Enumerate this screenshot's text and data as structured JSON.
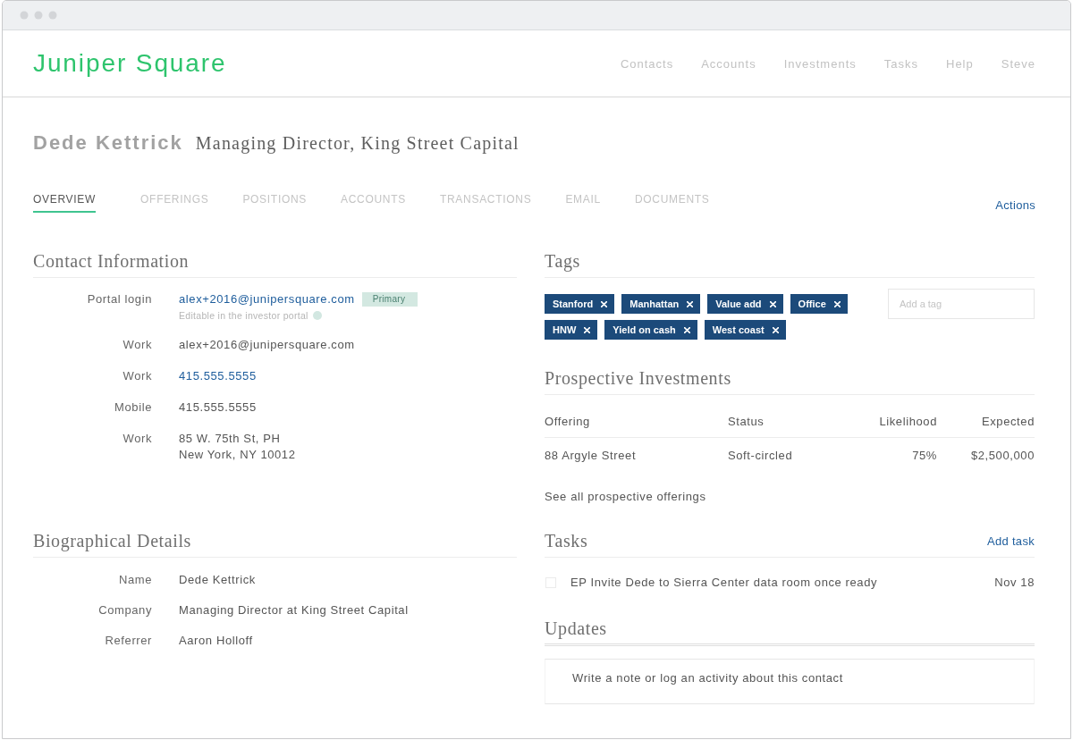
{
  "header": {
    "logo": "Juniper Square",
    "nav": [
      "Contacts",
      "Accounts",
      "Investments",
      "Tasks",
      "Help",
      "Steve"
    ]
  },
  "profile": {
    "name": "Dede Kettrick",
    "title": "Managing Director, King Street Capital"
  },
  "tabs": [
    {
      "label": "OVERVIEW",
      "selected": true
    },
    {
      "label": "OFFERINGS",
      "selected": false
    },
    {
      "label": "POSITIONS",
      "selected": false
    },
    {
      "label": "ACCOUNTS",
      "selected": false
    },
    {
      "label": "TRANSACTIONS",
      "selected": false
    },
    {
      "label": "EMAIL",
      "selected": false
    },
    {
      "label": "DOCUMENTS",
      "selected": false
    }
  ],
  "actions": "Actions",
  "contact_information": {
    "title": "Contact Information",
    "fields": [
      {
        "label": "Portal login",
        "kind": "link",
        "value": "alex+2016@junipersquare.com",
        "badge": "Primary",
        "note": "Editable in the investor portal"
      },
      {
        "label": "Work",
        "kind": "text",
        "value": "alex+2016@junipersquare.com"
      },
      {
        "label": "Work",
        "kind": "link",
        "value": "415.555.5555"
      },
      {
        "label": "Mobile",
        "kind": "text",
        "value": "415.555.5555"
      },
      {
        "label": "Work",
        "kind": "address",
        "lines": [
          "85 W. 75th St, PH",
          "New York, NY 10012"
        ]
      }
    ]
  },
  "tags": {
    "title": "Tags",
    "items": [
      "Stanford",
      "Manhattan",
      "Value add",
      "Office",
      "HNW",
      "Yield on cash",
      "West coast"
    ],
    "input": {
      "placeholder": "Add a tag"
    }
  },
  "prospective_investments": {
    "title": "Prospective Investments",
    "columns": [
      "Offering",
      "Status",
      "Likelihood",
      "Expected"
    ],
    "rows": [
      [
        "88 Argyle Street",
        "Soft-circled",
        "75%",
        "$2,500,000"
      ]
    ],
    "link": "See all prospective offerings"
  },
  "biographical_details": {
    "title": "Biographical Details",
    "fields": [
      {
        "label": "Name",
        "value": "Dede Kettrick"
      },
      {
        "label": "Company",
        "value": "Managing Director at King Street Capital"
      },
      {
        "label": "Referrer",
        "value": "Aaron Holloff"
      }
    ]
  },
  "tasks": {
    "title": "Tasks",
    "add": "Add task",
    "items": [
      {
        "text": "EP Invite Dede to Sierra Center data room once ready",
        "due": "Nov 18",
        "checked": false
      }
    ]
  },
  "updates": {
    "title": "Updates",
    "placeholder": "Write a note or log an activity about this contact"
  }
}
